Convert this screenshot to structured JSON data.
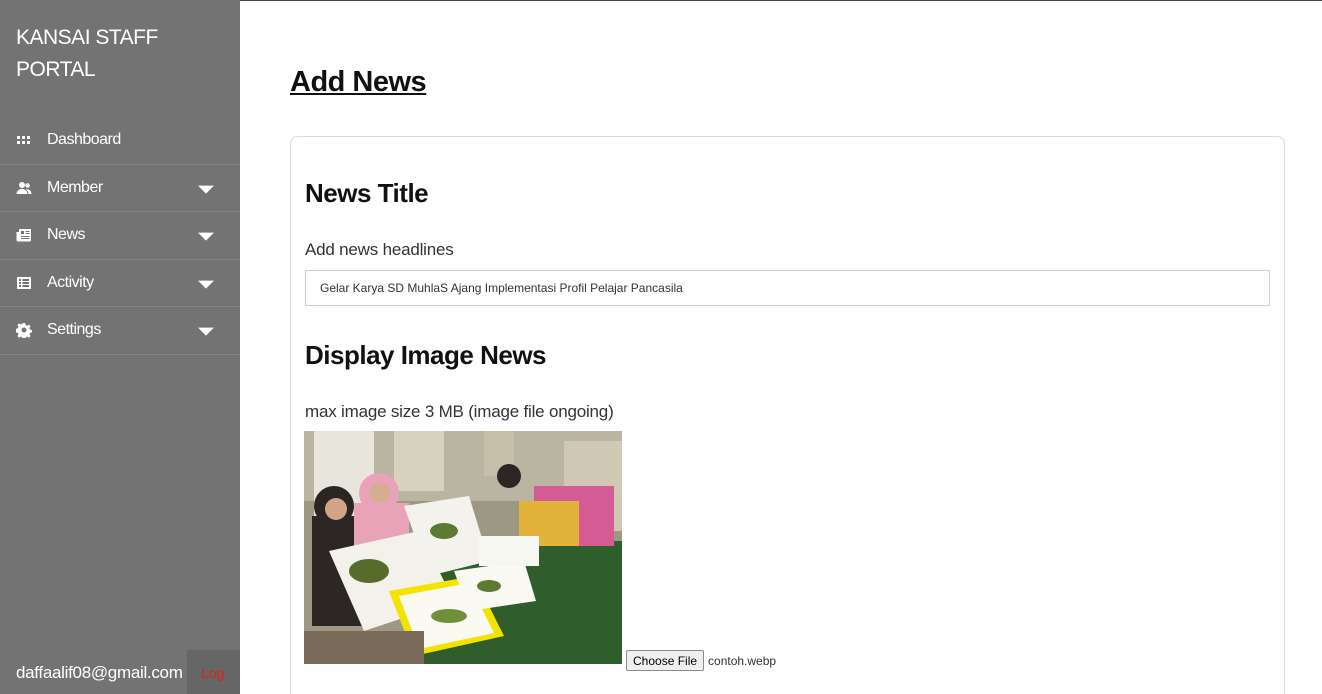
{
  "sidebar": {
    "brand": "KANSAI STAFF PORTAL",
    "brand_line1": "KANSAI STAFF",
    "brand_line2": "PORTAL",
    "items": [
      {
        "label": "Dashboard",
        "icon": "grid-icon",
        "has_caret": false
      },
      {
        "label": "Member",
        "icon": "users-icon",
        "has_caret": true
      },
      {
        "label": "News",
        "icon": "newspaper-icon",
        "has_caret": true
      },
      {
        "label": "Activity",
        "icon": "list-icon",
        "has_caret": true
      },
      {
        "label": "Settings",
        "icon": "gear-icon",
        "has_caret": true
      }
    ],
    "user_email": "daffaalif08@gmail.com",
    "logout_label": "Log"
  },
  "main": {
    "page_title": "Add News",
    "news_title_heading": "News Title",
    "headline_label": "Add news headlines",
    "headline_value": "Gelar Karya SD MuhlaS Ajang Implementasi Profil Pelajar Pancasila",
    "image_heading": "Display Image News",
    "image_hint": "max image size 3 MB (image file ongoing)",
    "choose_file_label": "Choose File",
    "file_name": "contoh.webp"
  },
  "colors": {
    "sidebar_bg": "#737373",
    "logout_text": "#e02020",
    "text_dark": "#111111"
  }
}
